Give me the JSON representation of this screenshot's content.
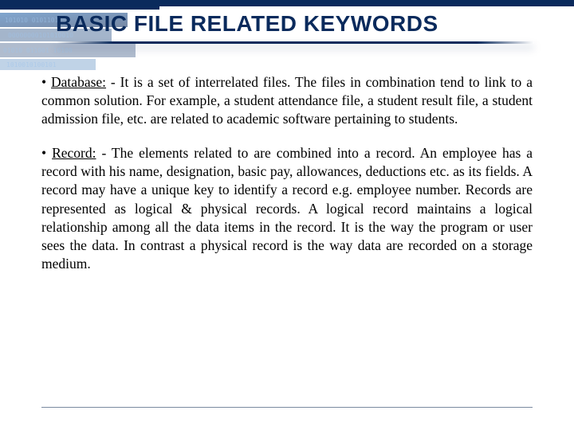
{
  "slide": {
    "title": "BASIC FILE RELATED KEYWORDS",
    "bullets": [
      {
        "term": "Database:",
        "text": " - It is a set of interrelated files. The files in combination tend to link to a common solution. For example, a student attendance file, a student result file, a student admission file, etc. are related to academic software pertaining to students."
      },
      {
        "term": "Record:",
        "text": " - The elements related to are combined into a record. An employee has a record with his name, designation, basic pay, allowances, deductions etc. as its fields. A record may have a unique key to identify a record e.g. employee number. Records are represented as logical & physical records. A logical record maintains a logical relationship among all the data items in the record. It is the way the program or user sees the data. In contrast a physical record is the way data are recorded on a storage medium."
      }
    ]
  }
}
